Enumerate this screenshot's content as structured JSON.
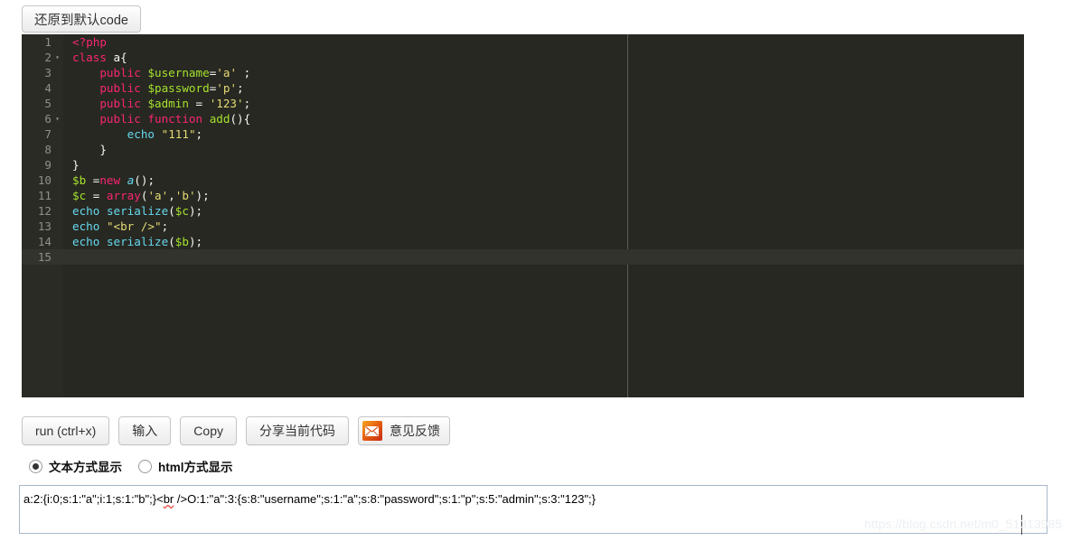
{
  "toolbar": {
    "restore_label": "还原到默认code"
  },
  "editor": {
    "language": "php",
    "active_line": 15,
    "lines": [
      {
        "num": "1",
        "fold": "",
        "tokens": [
          {
            "t": "&lt;?php",
            "c": "t-kw"
          }
        ]
      },
      {
        "num": "2",
        "fold": "▾",
        "tokens": [
          {
            "t": "class",
            "c": "t-kw"
          },
          {
            "t": " ",
            "c": "t-pun"
          },
          {
            "t": "a",
            "c": "t-pun"
          },
          {
            "t": "{",
            "c": "t-pun"
          }
        ]
      },
      {
        "num": "3",
        "fold": "",
        "tokens": [
          {
            "t": "    ",
            "c": "t-pun"
          },
          {
            "t": "public",
            "c": "t-kw"
          },
          {
            "t": " ",
            "c": "t-pun"
          },
          {
            "t": "$username",
            "c": "t-var"
          },
          {
            "t": "=",
            "c": "t-pun"
          },
          {
            "t": "'a'",
            "c": "t-str"
          },
          {
            "t": " ;",
            "c": "t-pun"
          }
        ]
      },
      {
        "num": "4",
        "fold": "",
        "tokens": [
          {
            "t": "    ",
            "c": "t-pun"
          },
          {
            "t": "public",
            "c": "t-kw"
          },
          {
            "t": " ",
            "c": "t-pun"
          },
          {
            "t": "$password",
            "c": "t-var"
          },
          {
            "t": "=",
            "c": "t-pun"
          },
          {
            "t": "'p'",
            "c": "t-str"
          },
          {
            "t": ";",
            "c": "t-pun"
          }
        ]
      },
      {
        "num": "5",
        "fold": "",
        "tokens": [
          {
            "t": "    ",
            "c": "t-pun"
          },
          {
            "t": "public",
            "c": "t-kw"
          },
          {
            "t": " ",
            "c": "t-pun"
          },
          {
            "t": "$admin",
            "c": "t-var"
          },
          {
            "t": " = ",
            "c": "t-pun"
          },
          {
            "t": "'123'",
            "c": "t-str"
          },
          {
            "t": ";",
            "c": "t-pun"
          }
        ]
      },
      {
        "num": "6",
        "fold": "▾",
        "tokens": [
          {
            "t": "    ",
            "c": "t-pun"
          },
          {
            "t": "public",
            "c": "t-kw"
          },
          {
            "t": " ",
            "c": "t-pun"
          },
          {
            "t": "function",
            "c": "t-kw"
          },
          {
            "t": " ",
            "c": "t-pun"
          },
          {
            "t": "add",
            "c": "t-fname"
          },
          {
            "t": "(){",
            "c": "t-pun"
          }
        ]
      },
      {
        "num": "7",
        "fold": "",
        "tokens": [
          {
            "t": "        ",
            "c": "t-pun"
          },
          {
            "t": "echo",
            "c": "t-fn"
          },
          {
            "t": " ",
            "c": "t-pun"
          },
          {
            "t": "\"111\"",
            "c": "t-str"
          },
          {
            "t": ";",
            "c": "t-pun"
          }
        ]
      },
      {
        "num": "8",
        "fold": "",
        "tokens": [
          {
            "t": "    }",
            "c": "t-pun"
          }
        ]
      },
      {
        "num": "9",
        "fold": "",
        "tokens": [
          {
            "t": "}",
            "c": "t-pun"
          }
        ]
      },
      {
        "num": "10",
        "fold": "",
        "tokens": [
          {
            "t": "$b",
            "c": "t-var"
          },
          {
            "t": " =",
            "c": "t-pun"
          },
          {
            "t": "new",
            "c": "t-kw"
          },
          {
            "t": " ",
            "c": "t-pun"
          },
          {
            "t": "a",
            "c": "t-cls"
          },
          {
            "t": "();",
            "c": "t-pun"
          }
        ]
      },
      {
        "num": "11",
        "fold": "",
        "tokens": [
          {
            "t": "$c",
            "c": "t-var"
          },
          {
            "t": " = ",
            "c": "t-pun"
          },
          {
            "t": "array",
            "c": "t-kw"
          },
          {
            "t": "(",
            "c": "t-pun"
          },
          {
            "t": "'a'",
            "c": "t-str"
          },
          {
            "t": ",",
            "c": "t-pun"
          },
          {
            "t": "'b'",
            "c": "t-str"
          },
          {
            "t": ");",
            "c": "t-pun"
          }
        ]
      },
      {
        "num": "12",
        "fold": "",
        "tokens": [
          {
            "t": "echo",
            "c": "t-fn"
          },
          {
            "t": " ",
            "c": "t-pun"
          },
          {
            "t": "serialize",
            "c": "t-fn"
          },
          {
            "t": "(",
            "c": "t-pun"
          },
          {
            "t": "$c",
            "c": "t-var"
          },
          {
            "t": ");",
            "c": "t-pun"
          }
        ]
      },
      {
        "num": "13",
        "fold": "",
        "tokens": [
          {
            "t": "echo",
            "c": "t-fn"
          },
          {
            "t": " ",
            "c": "t-pun"
          },
          {
            "t": "\"&lt;br /&gt;\"",
            "c": "t-str"
          },
          {
            "t": ";",
            "c": "t-pun"
          }
        ]
      },
      {
        "num": "14",
        "fold": "",
        "tokens": [
          {
            "t": "echo",
            "c": "t-fn"
          },
          {
            "t": " ",
            "c": "t-pun"
          },
          {
            "t": "serialize",
            "c": "t-fn"
          },
          {
            "t": "(",
            "c": "t-pun"
          },
          {
            "t": "$b",
            "c": "t-var"
          },
          {
            "t": ");",
            "c": "t-pun"
          }
        ]
      },
      {
        "num": "15",
        "fold": "",
        "tokens": [
          {
            "t": "",
            "c": "t-pun"
          }
        ]
      }
    ]
  },
  "actions": {
    "run_label": "run (ctrl+x)",
    "input_label": "输入",
    "copy_label": "Copy",
    "share_label": "分享当前代码",
    "feedback_label": "意见反馈",
    "feedback_icon": "mail-icon"
  },
  "display_mode": {
    "options": [
      {
        "label": "文本方式显示",
        "checked": true
      },
      {
        "label": "html方式显示",
        "checked": false
      }
    ]
  },
  "output": {
    "part1": "a:2:{i:0;s:1:\"a\";i:1;s:1:\"b\";}<",
    "spell": "br",
    "part2": " />O:1:\"a\":3:{s:8:\"username\";s:1:\"a\";s:8:\"password\";s:1:\"p\";s:5:\"admin\";s:3:\"123\";}"
  },
  "watermark": {
    "text": "https://blog.csdn.net/m0_51313985"
  },
  "colors": {
    "editor_bg": "#272822",
    "gutter_bg": "#2b2b26",
    "keyword": "#f92672",
    "variable": "#a6e22e",
    "string": "#e6db74",
    "builtin": "#66d9ef"
  }
}
